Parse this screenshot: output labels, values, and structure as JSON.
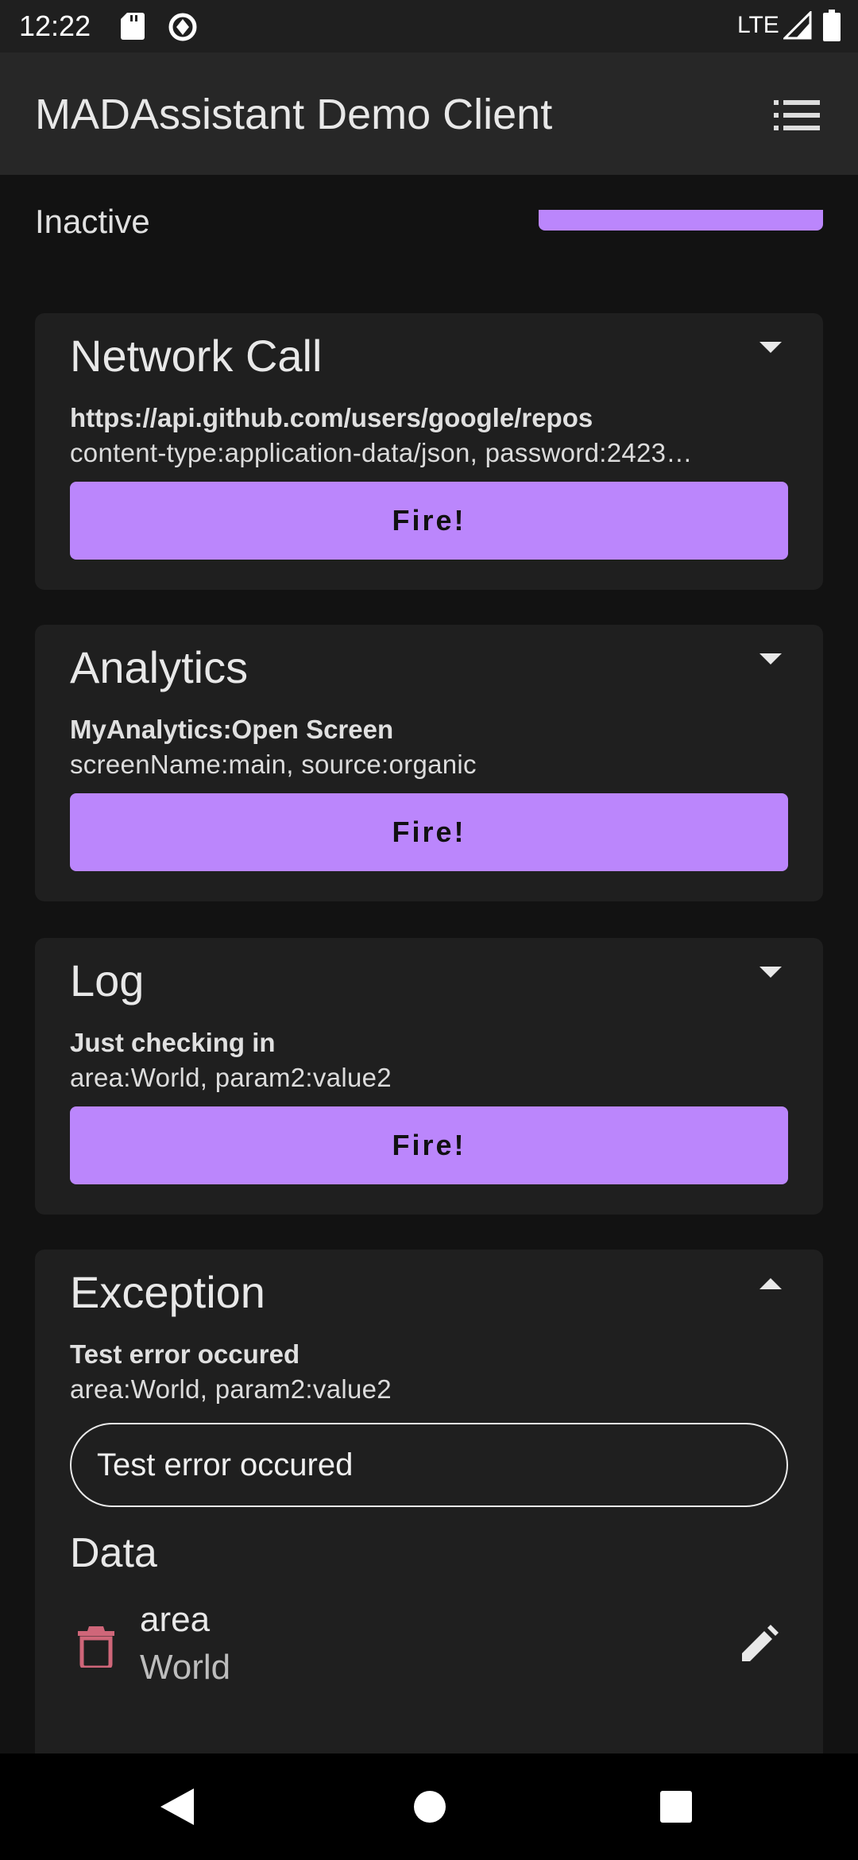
{
  "status_bar": {
    "time": "12:22",
    "network": "LTE",
    "icons": [
      "sd-card-icon",
      "sync-icon",
      "signal-icon",
      "battery-icon"
    ]
  },
  "app_bar": {
    "title": "MADAssistant Demo Client",
    "menu_icon": "menu-icon"
  },
  "content": {
    "status_label": "Inactive",
    "cards": [
      {
        "title": "Network Call",
        "subtitle": "https://api.github.com/users/google/repos",
        "params": "content-type:application-data/json, password:2423…",
        "button_label": "Fire!",
        "expanded": false
      },
      {
        "title": "Analytics",
        "subtitle": "MyAnalytics:Open Screen",
        "params": "screenName:main, source:organic",
        "button_label": "Fire!",
        "expanded": false
      },
      {
        "title": "Log",
        "subtitle": "Just checking in",
        "params": "area:World, param2:value2",
        "button_label": "Fire!",
        "expanded": false
      },
      {
        "title": "Exception",
        "subtitle": "Test error occured",
        "params": "area:World, param2:value2",
        "expanded": true,
        "input_value": "Test error occured",
        "data_heading": "Data",
        "data_items": [
          {
            "key": "area",
            "value": "World"
          }
        ]
      }
    ]
  },
  "colors": {
    "background": "#121212",
    "card": "#1f1f1f",
    "app_bar": "#272727",
    "accent": "#bb86fc",
    "delete": "#cf6679"
  }
}
